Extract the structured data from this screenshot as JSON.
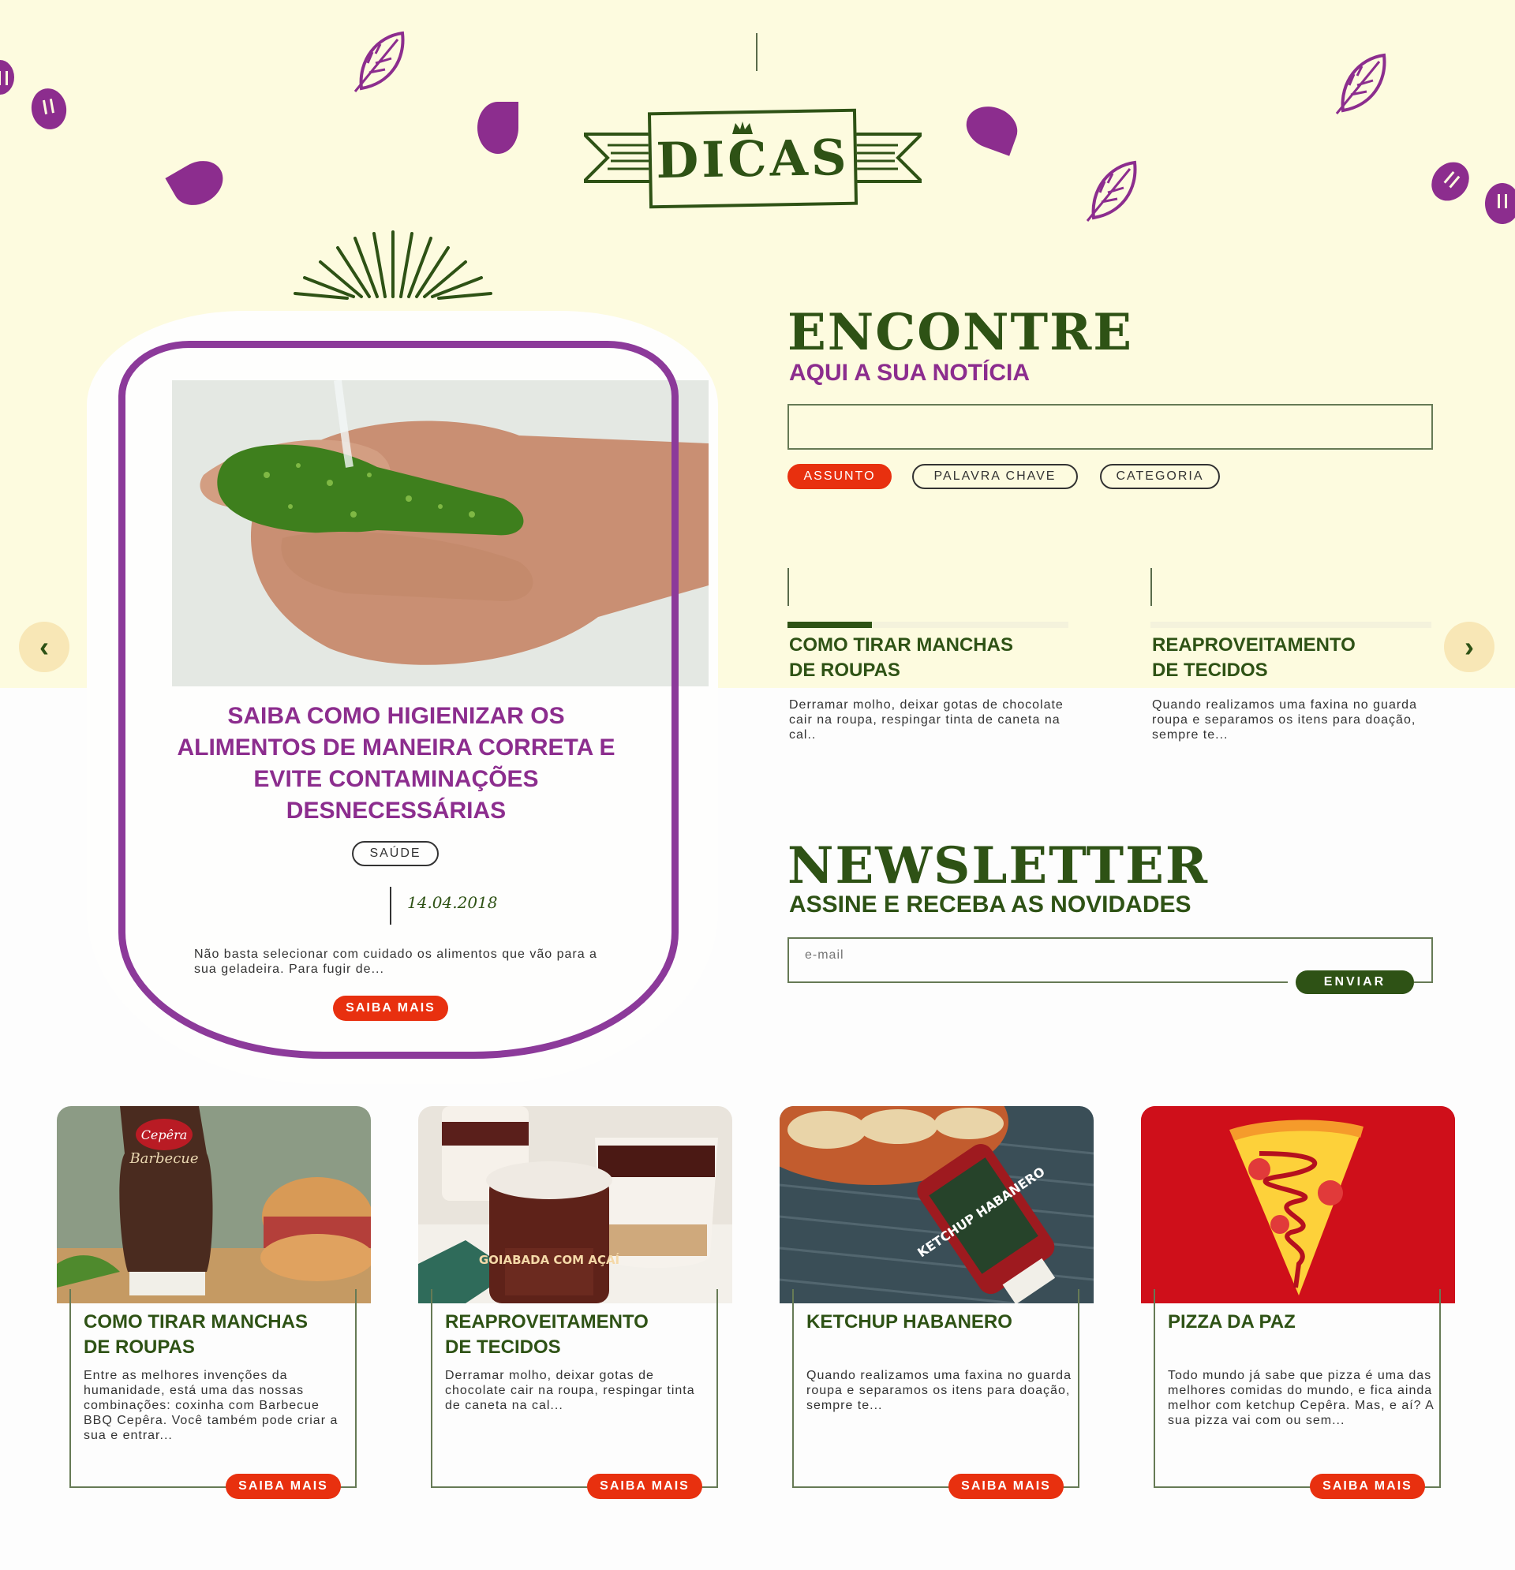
{
  "banner": {
    "title": "DICAS"
  },
  "featured": {
    "title": "SAIBA COMO HIGIENIZAR OS ALIMENTOS DE MANEIRA CORRETA E EVITE CONTAMINAÇÕES DESNECESSÁRIAS",
    "tag": "SAÚDE",
    "date": "14.04.2018",
    "excerpt": "Não basta selecionar com cuidado os alimentos que vão para a sua geladeira. Para fugir de...",
    "cta": "SAIBA MAIS"
  },
  "nav": {
    "prev_icon": "chevron-left-icon",
    "next_icon": "chevron-right-icon",
    "prev": "‹",
    "next": "›"
  },
  "search": {
    "heading": "ENCONTRE",
    "subheading": "AQUI A SUA NOTÍCIA",
    "value": "",
    "filters": [
      {
        "label": "ASSUNTO",
        "active": true
      },
      {
        "label": "PALAVRA CHAVE",
        "active": false
      },
      {
        "label": "CATEGORIA",
        "active": false
      }
    ]
  },
  "news": [
    {
      "title_line1": "COMO TIRAR MANCHAS",
      "title_line2": "DE ROUPAS",
      "excerpt": "Derramar molho, deixar gotas de chocolate cair na roupa, respingar tinta de caneta na cal..",
      "progress": 0.3
    },
    {
      "title_line1": "REAPROVEITAMENTO",
      "title_line2": "DE TECIDOS",
      "excerpt": "Quando realizamos uma faxina no guarda roupa e separamos os itens para doação, sempre te...",
      "progress": 0
    }
  ],
  "newsletter": {
    "heading": "NEWSLETTER",
    "subheading": "ASSINE E RECEBA AS NOVIDADES",
    "placeholder": "e-mail",
    "button": "ENVIAR"
  },
  "cards": [
    {
      "title_line1": "COMO TIRAR MANCHAS",
      "title_line2": "DE ROUPAS",
      "excerpt": "Entre as melhores invenções da humanidade, está uma das nossas combinações: coxinha com Barbecue BBQ Cepêra. Você também pode criar a sua e entrar...",
      "cta": "SAIBA MAIS",
      "image": "barbecue-sauce-burger",
      "bottle_brand": "Cepêra",
      "bottle_label": "Barbecue"
    },
    {
      "title_line1": "REAPROVEITAMENTO",
      "title_line2": "DE TECIDOS",
      "excerpt": "Derramar molho, deixar gotas de chocolate cair na roupa, respingar tinta de caneta na cal...",
      "cta": "SAIBA MAIS",
      "image": "goiabada-acai-dessert",
      "jar_label": "GOIABADA COM AÇAÍ"
    },
    {
      "title_line1": "KETCHUP HABANERO",
      "title_line2": "",
      "excerpt": "Quando realizamos uma faxina no guarda roupa e separamos os itens para doação, sempre te...",
      "cta": "SAIBA MAIS",
      "image": "ketchup-habanero-tacos",
      "bottle_label": "KETCHUP HABANERO"
    },
    {
      "title_line1": "PIZZA DA PAZ",
      "title_line2": "",
      "excerpt": "Todo mundo já sabe que pizza é uma das melhores comidas do mundo, e fica ainda melhor com ketchup Cepêra. Mas, e aí? A sua pizza vai com ou sem...",
      "cta": "SAIBA MAIS",
      "image": "pizza-slice-illustration"
    }
  ],
  "colors": {
    "hero_bg": "#fdfbdf",
    "green": "#2e5215",
    "purple": "#8c2d8e",
    "red": "#e8300f",
    "pizza_red": "#cf0f1a"
  }
}
